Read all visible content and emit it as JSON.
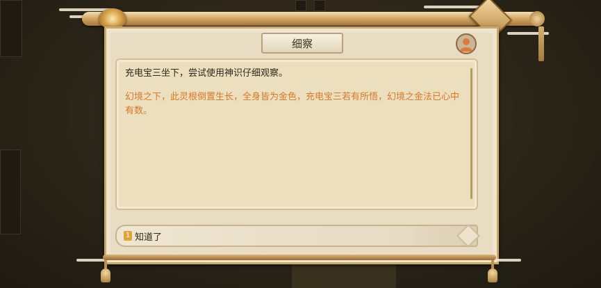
{
  "dialog": {
    "title": "细察",
    "narration": "充电宝三坐下，尝试使用神识仔细观察。",
    "highlight_text": "幻境之下，此灵根倒置生长，全身皆为金色，充电宝三若有所悟，幻境之金法已心中有数。",
    "options": [
      {
        "index": "1",
        "label": "知道了"
      }
    ]
  },
  "icons": {
    "avatar": "user-avatar-icon",
    "option_marker": "number-badge-icon"
  },
  "colors": {
    "narration": "#2e261b",
    "highlight": "#d8792a",
    "paper": "#e8dcc2",
    "frame_gold": "#c9a86b"
  }
}
